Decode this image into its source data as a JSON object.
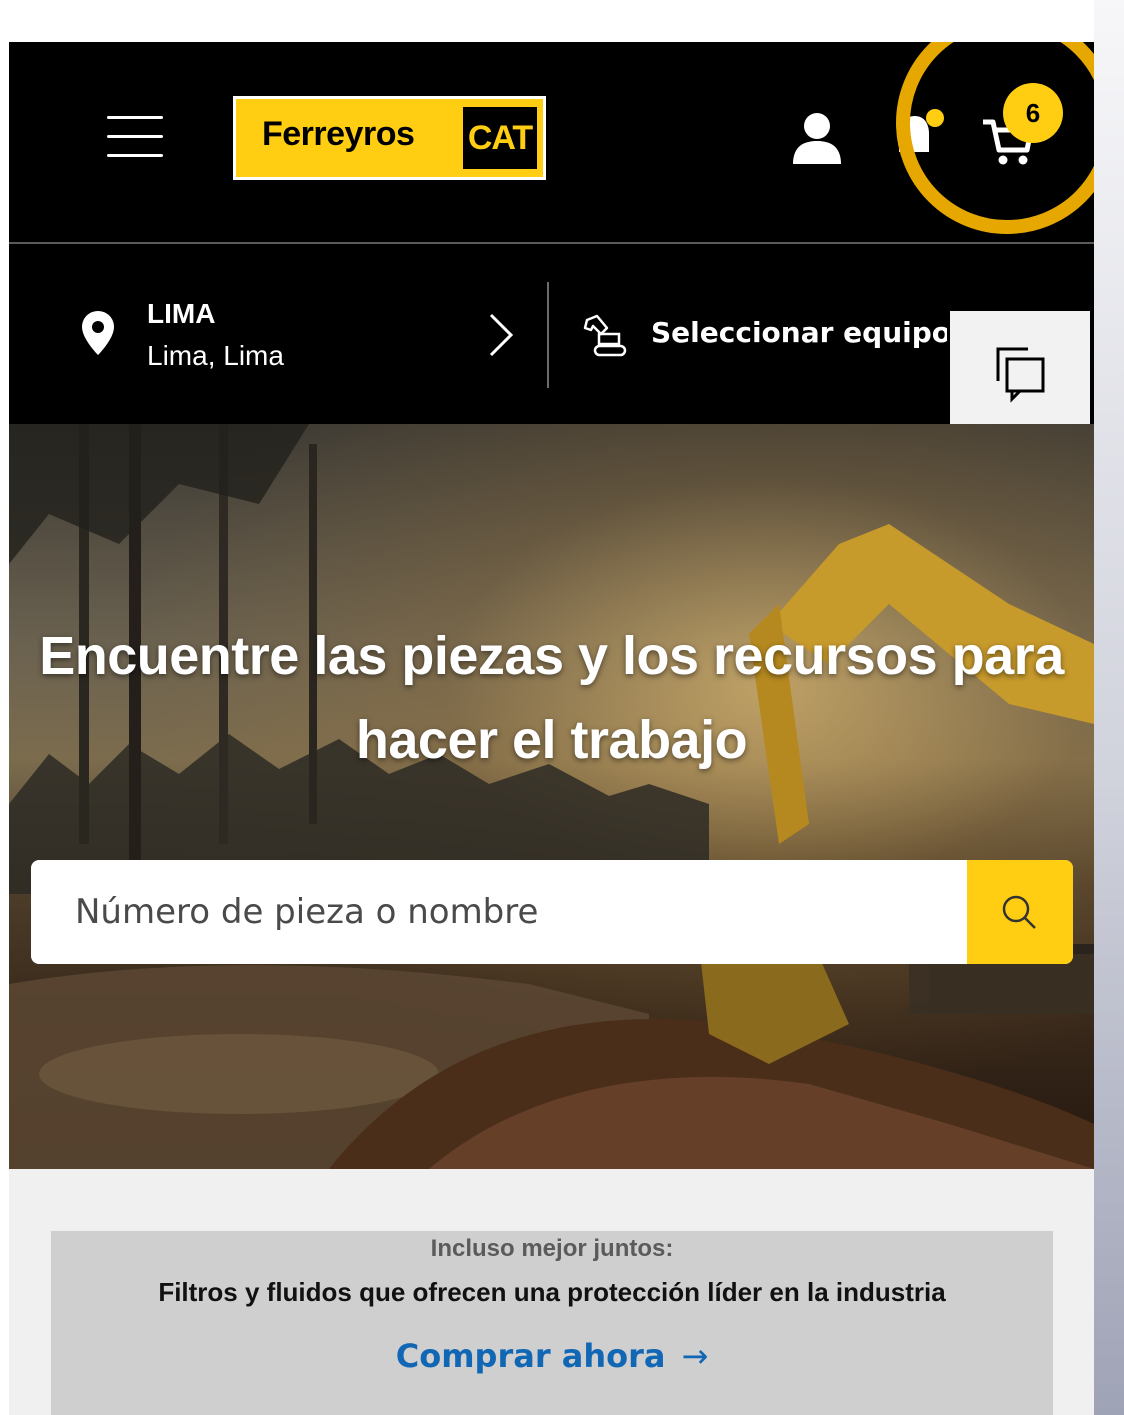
{
  "header": {
    "brand_name": "Ferreyros",
    "brand_badge": "CAT",
    "cart_count": "6",
    "icons": [
      "menu-icon",
      "user-icon",
      "bell-icon",
      "cart-icon"
    ]
  },
  "location": {
    "title": "LIMA",
    "subtitle": "Lima, Lima",
    "select_equipment_label": "Seleccionar equipo"
  },
  "hero": {
    "title": "Encuentre las piezas y los recursos para hacer el trabajo"
  },
  "search": {
    "placeholder": "Número de pieza o nombre"
  },
  "promo": {
    "kicker": "Incluso mejor juntos:",
    "headline": "Filtros y fluidos que ofrecen una protección líder en la industria",
    "cta_label": "Comprar ahora",
    "cta_arrow": "→"
  },
  "colors": {
    "brand_yellow": "#ffcd11",
    "highlight_ring": "#e6a800",
    "link_blue": "#1267b5",
    "header_bg": "#000000"
  }
}
